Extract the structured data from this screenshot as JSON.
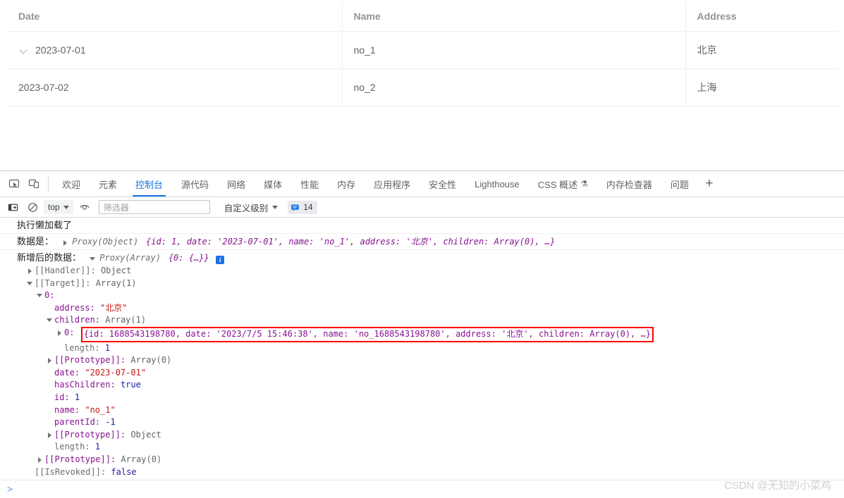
{
  "table": {
    "columns": [
      "Date",
      "Name",
      "Address"
    ],
    "rows": [
      {
        "date": "2023-07-01",
        "name": "no_1",
        "address": "北京",
        "expandable": true,
        "child": false
      },
      {
        "date": "2023-07-02",
        "name": "no_2",
        "address": "上海",
        "expandable": false,
        "child": true
      }
    ]
  },
  "devtools": {
    "icons": {
      "inspect": "inspect-element-icon",
      "device": "device-toolbar-icon"
    },
    "tabs": [
      {
        "label": "欢迎",
        "active": false
      },
      {
        "label": "元素",
        "active": false
      },
      {
        "label": "控制台",
        "active": true
      },
      {
        "label": "源代码",
        "active": false
      },
      {
        "label": "网络",
        "active": false
      },
      {
        "label": "媒体",
        "active": false
      },
      {
        "label": "性能",
        "active": false
      },
      {
        "label": "内存",
        "active": false
      },
      {
        "label": "应用程序",
        "active": false
      },
      {
        "label": "安全性",
        "active": false
      },
      {
        "label": "Lighthouse",
        "active": false
      },
      {
        "label": "CSS 概述",
        "active": false,
        "badge": "⚗"
      },
      {
        "label": "内存检查器",
        "active": false
      },
      {
        "label": "问题",
        "active": false
      }
    ],
    "add_tab_label": "+",
    "console_toolbar": {
      "sidebar_toggle": "console-sidebar-icon",
      "clear_label": "clear-console-icon",
      "context": "top",
      "eye_icon": "live-expression-icon",
      "filter_placeholder": "筛选器",
      "filter_value": "",
      "level_label": "自定义级别",
      "message_count": "14",
      "message_icon": "message-count-icon"
    },
    "accent_color": "#1a73e8",
    "highlight_color": "#ff0000"
  },
  "console": {
    "line1": {
      "label": "执行懒加载了"
    },
    "line2": {
      "label": "数据是：",
      "class": "Proxy(Object)",
      "preview": "{id: 1, date: '2023-07-01', name: 'no_1', address: '北京', children: Array(0), …}"
    },
    "line3": {
      "label": "新增后的数据：",
      "class": "Proxy(Array)",
      "preview": "{0: {…}}"
    },
    "tree": [
      {
        "indent": 1,
        "arrow": "closed",
        "key": "[[Handler]]",
        "value": "Object",
        "key_style": "grey",
        "value_style": "cls"
      },
      {
        "indent": 1,
        "arrow": "open",
        "key": "[[Target]]",
        "value": "Array(1)",
        "key_style": "grey",
        "value_style": "cls"
      },
      {
        "indent": 2,
        "arrow": "open",
        "key": "0",
        "value": "",
        "key_style": "purple",
        "value_style": "plain"
      },
      {
        "indent": 3,
        "arrow": "none",
        "key": "address",
        "value": "\"北京\"",
        "key_style": "purple",
        "value_style": "red"
      },
      {
        "indent": 3,
        "arrow": "open",
        "key": "children",
        "value": "Array(1)",
        "key_style": "purple",
        "value_style": "cls"
      },
      {
        "indent": 4,
        "arrow": "closed",
        "key": "0",
        "value": "{id: 1688543198780, date: '2023/7/5 15:46:38', name: 'no_1688543198780', address: '北京', children: Array(0), …}",
        "key_style": "purple",
        "value_style": "preview",
        "highlight": true
      },
      {
        "indent": 4,
        "arrow": "none",
        "key": "length",
        "value": "1",
        "key_style": "grey",
        "value_style": "blue"
      },
      {
        "indent": 3,
        "arrow": "closed",
        "key": "[[Prototype]]",
        "value": "Array(0)",
        "key_style": "purple",
        "value_style": "cls"
      },
      {
        "indent": 3,
        "arrow": "none",
        "key": "date",
        "value": "\"2023-07-01\"",
        "key_style": "purple",
        "value_style": "red"
      },
      {
        "indent": 3,
        "arrow": "none",
        "key": "hasChildren",
        "value": "true",
        "key_style": "purple",
        "value_style": "blue"
      },
      {
        "indent": 3,
        "arrow": "none",
        "key": "id",
        "value": "1",
        "key_style": "purple",
        "value_style": "blue"
      },
      {
        "indent": 3,
        "arrow": "none",
        "key": "name",
        "value": "\"no_1\"",
        "key_style": "purple",
        "value_style": "red"
      },
      {
        "indent": 3,
        "arrow": "none",
        "key": "parentId",
        "value": "-1",
        "key_style": "purple",
        "value_style": "blue"
      },
      {
        "indent": 3,
        "arrow": "closed",
        "key": "[[Prototype]]",
        "value": "Object",
        "key_style": "purple",
        "value_style": "cls"
      },
      {
        "indent": 3,
        "arrow": "none",
        "key": "length",
        "value": "1",
        "key_style": "grey",
        "value_style": "blue"
      },
      {
        "indent": 2,
        "arrow": "closed",
        "key": "[[Prototype]]",
        "value": "Array(0)",
        "key_style": "purple",
        "value_style": "cls"
      },
      {
        "indent": 1,
        "arrow": "none",
        "key": "[[IsRevoked]]",
        "value": "false",
        "key_style": "grey",
        "value_style": "blue"
      }
    ],
    "prompt": ">"
  },
  "watermark": "CSDN @无知的小菜鸡"
}
